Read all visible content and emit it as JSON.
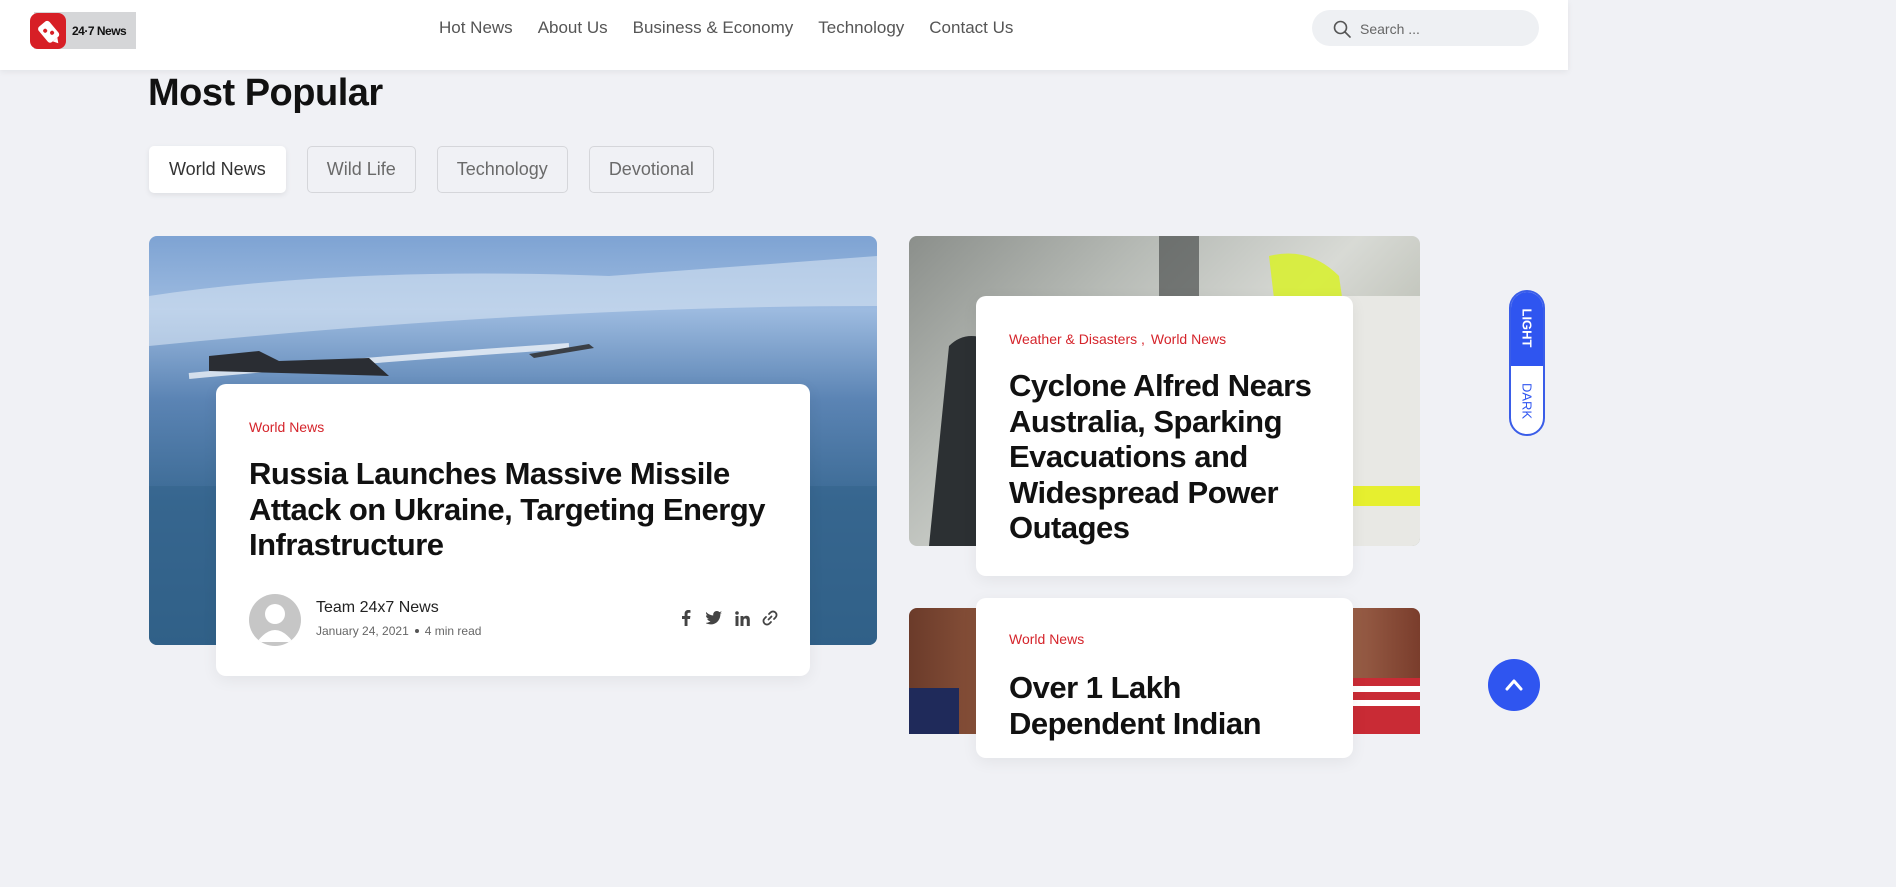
{
  "header": {
    "logo_text": "24·7 News",
    "nav": [
      "Hot News",
      "About Us",
      "Business & Economy",
      "Technology",
      "Contact Us"
    ],
    "search_placeholder": "Search ..."
  },
  "section": {
    "title": "Most Popular",
    "tabs": [
      "World News",
      "Wild Life",
      "Technology",
      "Devotional"
    ],
    "active_tab": "World News"
  },
  "main_article": {
    "category": "World News",
    "title": "Russia Launches Massive Missile Attack on Ukraine, Targeting Energy Infrastructure",
    "author": "Team 24x7 News",
    "date": "January 24, 2021",
    "read_time": "4 min read",
    "social_icons": [
      "facebook-icon",
      "twitter-icon",
      "linkedin-icon",
      "link-icon"
    ]
  },
  "side_articles": [
    {
      "categories": [
        "Weather & Disasters ,",
        "World News"
      ],
      "title": "Cyclone Alfred Nears Australia, Sparking Evacuations and Widespread Power Outages"
    },
    {
      "categories": [
        "World News"
      ],
      "title": "Over 1 Lakh Dependent Indian"
    }
  ],
  "theme_toggle": {
    "light": "LIGHT",
    "dark": "DARK"
  },
  "colors": {
    "accent": "#2f55f0",
    "category": "#d5242b",
    "brand_red": "#d71f26"
  }
}
